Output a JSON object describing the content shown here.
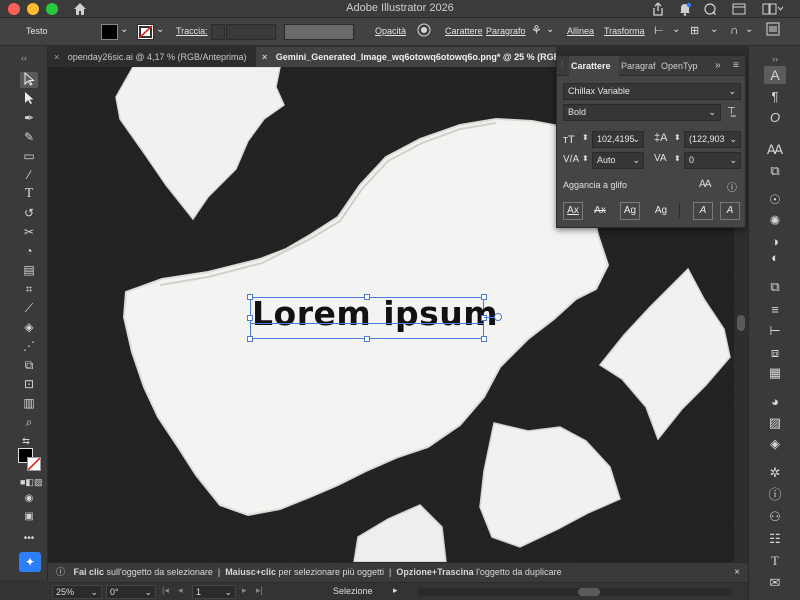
{
  "window": {
    "title": "Adobe Illustrator 2026"
  },
  "controlbar": {
    "tool_label": "Testo",
    "stroke_label": "Traccia:",
    "opacity_label": "Opacità",
    "character_label": "Carattere",
    "paragraph_label": "Paragrafo",
    "align_label": "Allinea",
    "transform_label": "Trasforma"
  },
  "tabs": [
    {
      "label": "openday26sic.ai @ 4,17 % (RGB/Anteprima)",
      "active": false
    },
    {
      "label": "Gemini_Generated_Image_wq6otowq6otowq6o.png* @ 25 % (RGB/Ante",
      "active": true
    }
  ],
  "character_panel": {
    "tabs": [
      "Carattere",
      "Paragraf",
      "OpenTyp"
    ],
    "font_family": "Chillax Variable",
    "font_style": "Bold",
    "font_size": "102,4195",
    "leading": "(122,903",
    "kerning": "Auto",
    "tracking": "0",
    "snap_label": "Aggancia a glifo",
    "snap_buttons": [
      "Ax",
      "Ax",
      "Ag",
      "Ag",
      "A",
      "A"
    ]
  },
  "artwork": {
    "text": "Lorem ipsum"
  },
  "hint": {
    "part1_bold": "Fai clic",
    "part1": " sull'oggetto da selezionare",
    "sep": "  |  ",
    "part2_bold": "Maiusc+clic",
    "part2": " per selezionare più oggetti",
    "part3_bold": "Opzione+Trascina",
    "part3": " l'oggetto da duplicare"
  },
  "statusbar": {
    "zoom": "25%",
    "rotation": "0°",
    "artboard": "1",
    "tool_status": "Selezione"
  },
  "colors": {
    "accent": "#2d7ff9",
    "selection": "#4a7bdc"
  },
  "icons": {
    "left_tools": [
      "selection-tool-icon",
      "direct-selection-tool-icon",
      "pen-tool-icon",
      "curvature-tool-icon",
      "rectangle-tool-icon",
      "paintbrush-tool-icon",
      "type-tool-icon",
      "rotate-tool-icon",
      "scissors-tool-icon",
      "shape-builder-tool-icon",
      "gradient-tool-icon",
      "mesh-tool-icon",
      "eyedropper-tool-icon",
      "blend-tool-icon",
      "symbol-sprayer-tool-icon",
      "artboard-tool-icon",
      "column-graph-tool-icon",
      "zoom-tool-icon"
    ],
    "right_tools": [
      "character-panel-icon",
      "paragraph-panel-icon",
      "opentype-panel-icon",
      "glyphs-icon",
      "transform-icon",
      "pathfinder-icon",
      "appearance-icon",
      "color-guide-icon",
      "swatches-icon",
      "brushes-icon",
      "symbols-icon",
      "stroke-icon",
      "align-icon",
      "gradient-icon",
      "transparency-icon",
      "layers-icon",
      "properties-icon",
      "info-icon",
      "libraries-icon",
      "asset-export-icon",
      "links-icon"
    ]
  }
}
